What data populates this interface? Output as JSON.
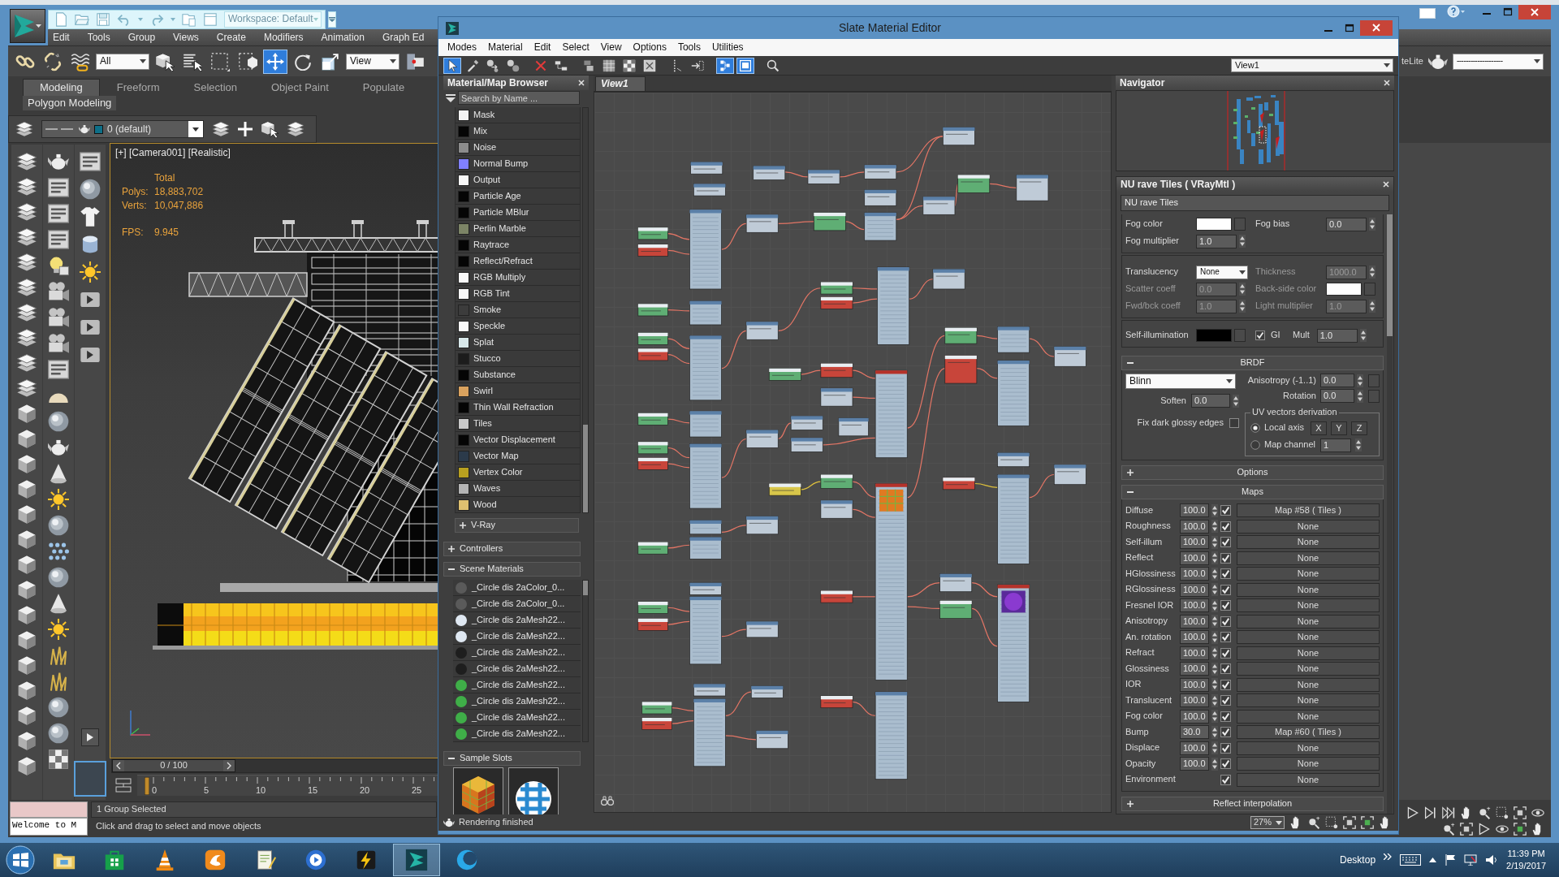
{
  "main_window": {
    "quick_access": {
      "workspace": "Workspace: Default"
    },
    "menu": [
      "Edit",
      "Tools",
      "Group",
      "Views",
      "Create",
      "Modifiers",
      "Animation",
      "Graph Ed"
    ],
    "toolbar": {
      "selection_filter": "All",
      "transform_tools": [
        {
          "selected": true
        },
        {
          "selected": false
        },
        {
          "selected": false
        }
      ],
      "reference_coordinate": "View",
      "right_label": "teLite",
      "named_selection": "--------------------"
    },
    "ribbon": {
      "tabs": [
        {
          "label": "Modeling",
          "selected": true
        },
        {
          "label": "Freeform",
          "selected": false
        },
        {
          "label": "Selection",
          "selected": false
        },
        {
          "label": "Object Paint",
          "selected": false
        },
        {
          "label": "Populate",
          "selected": false
        }
      ],
      "panel": "Polygon Modeling"
    },
    "layer_toolbar": {
      "layer": "0 (default)"
    },
    "viewport": {
      "label": "[+] [Camera001] [Realistic]",
      "stats_heading": "Total",
      "stats": [
        {
          "label": "Polys:",
          "value": "18,883,702"
        },
        {
          "label": "Verts:",
          "value": "10,047,886"
        }
      ],
      "fps": {
        "label": "FPS:",
        "value": "9.945"
      }
    },
    "time_slider": {
      "frame": "0 / 100",
      "level": 0,
      "ticks": [
        "0",
        "5",
        "10",
        "15",
        "20",
        "25"
      ]
    },
    "status_bar": {
      "listener": "Welcome to M",
      "selection": "1 Group Selected",
      "prompt": "Click and drag to select and move objects"
    }
  },
  "slate_editor": {
    "title": "Slate Material Editor",
    "menu": [
      "Modes",
      "Material",
      "Edit",
      "Select",
      "View",
      "Options",
      "Tools",
      "Utilities"
    ],
    "toolbar": {
      "tools": [
        {
          "on": true
        },
        {
          "on": false
        },
        {
          "on": false
        },
        {
          "on": false
        },
        {
          "on": false
        },
        {
          "on": false
        },
        {
          "on": false
        },
        {
          "on": false
        },
        {
          "on": false
        },
        {
          "on": false
        },
        {
          "on": false
        },
        {
          "on": false
        },
        {
          "on": true
        },
        {
          "on": true
        },
        {
          "on": false
        }
      ],
      "view": "View1"
    },
    "browser": {
      "title": "Material/Map Browser",
      "search": {
        "placeholder": "Search by Name ..."
      },
      "maps": [
        {
          "name": "Mask",
          "color": "#f4f4f4"
        },
        {
          "name": "Mix",
          "color": "#050505"
        },
        {
          "name": "Noise",
          "color": "#8c8c8c"
        },
        {
          "name": "Normal Bump",
          "color": "#8080ff"
        },
        {
          "name": "Output",
          "color": "#f8f8f8"
        },
        {
          "name": "Particle Age",
          "color": "#050505"
        },
        {
          "name": "Particle MBlur",
          "color": "#050505"
        },
        {
          "name": "Perlin Marble",
          "color": "#7c8466"
        },
        {
          "name": "Raytrace",
          "color": "#050505"
        },
        {
          "name": "Reflect/Refract",
          "color": "#050505"
        },
        {
          "name": "RGB Multiply",
          "color": "#f8f8f8"
        },
        {
          "name": "RGB Tint",
          "color": "#f8f8f8"
        },
        {
          "name": "Smoke",
          "color": "#3c3c3c"
        },
        {
          "name": "Speckle",
          "color": "#f8f8f8"
        },
        {
          "name": "Splat",
          "color": "#d8e8ea"
        },
        {
          "name": "Stucco",
          "color": "#1c1c1c"
        },
        {
          "name": "Substance",
          "color": "#050505"
        },
        {
          "name": "Swirl",
          "color": "#d9a25e"
        },
        {
          "name": "Thin Wall Refraction",
          "color": "#050505"
        },
        {
          "name": "Tiles",
          "color": "#c9c9c9"
        },
        {
          "name": "Vector Displacement",
          "color": "#050505"
        },
        {
          "name": "Vector Map",
          "color": "#2b3a4a"
        },
        {
          "name": "Vertex Color",
          "color": "#b8a020"
        },
        {
          "name": "Waves",
          "color": "#b4b4b4"
        },
        {
          "name": "Wood",
          "color": "#dfc070"
        }
      ],
      "sections": [
        {
          "label": "V-Ray",
          "kind": "subgroup",
          "expanded": false
        },
        {
          "label": "Controllers",
          "kind": "group",
          "expanded": false
        },
        {
          "label": "Scene Materials",
          "kind": "group",
          "expanded": true,
          "items": [
            {
              "name": "_Circle dis 2aColor_0...",
              "color": "#5a5a5a"
            },
            {
              "name": "_Circle dis 2aColor_0...",
              "color": "#5a5a5a"
            },
            {
              "name": "_Circle dis 2aMesh22...",
              "color": "#dfe8f2"
            },
            {
              "name": "_Circle dis 2aMesh22...",
              "color": "#dfe8f2"
            },
            {
              "name": "_Circle dis 2aMesh22...",
              "color": "#1e1e1e"
            },
            {
              "name": "_Circle dis 2aMesh22...",
              "color": "#1e1e1e"
            },
            {
              "name": "_Circle dis 2aMesh22...",
              "color": "#3fae48"
            },
            {
              "name": "_Circle dis 2aMesh22...",
              "color": "#3fae48"
            },
            {
              "name": "_Circle dis 2aMesh22...",
              "color": "#3fae48"
            },
            {
              "name": "_Circle dis 2aMesh22...",
              "color": "#3fae48"
            }
          ]
        },
        {
          "label": "Sample Slots",
          "kind": "group",
          "expanded": true,
          "slots": [
            {
              "kind": "cube"
            },
            {
              "kind": "sphere"
            }
          ]
        }
      ]
    },
    "view": {
      "tabs": [
        {
          "label": "View1",
          "selected": true
        }
      ],
      "zoom": "27%"
    },
    "navigator": {
      "title": "Navigator"
    },
    "material": {
      "title": "NU rave Tiles ( VRayMtl )",
      "name": "NU rave Tiles",
      "groups": [
        [
          [
            {
              "label": "Fog color",
              "kind": "swatch",
              "color": "#ffffff",
              "disabled": false
            },
            {
              "label": "Fog bias",
              "kind": "spinner",
              "value": "0.0",
              "disabled": false
            }
          ],
          [
            {
              "label": "Fog multiplier",
              "kind": "spinner",
              "value": "1.0",
              "disabled": false
            }
          ]
        ],
        [
          [
            {
              "label": "Translucency",
              "kind": "dropdown",
              "value": "None",
              "disabled": false
            },
            {
              "label": "Thickness",
              "kind": "spinner",
              "value": "1000.0",
              "disabled": true
            }
          ],
          [
            {
              "label": "Scatter coeff",
              "kind": "spinner",
              "value": "0.0",
              "disabled": true
            },
            {
              "label": "Back-side color",
              "kind": "swatch",
              "color": "#ffffff",
              "disabled": true
            }
          ],
          [
            {
              "label": "Fwd/bck coeff",
              "kind": "spinner",
              "value": "1.0",
              "disabled": true
            },
            {
              "label": "Light multiplier",
              "kind": "spinner",
              "value": "1.0",
              "disabled": true
            }
          ]
        ],
        [
          [
            {
              "label": "Self-illumination",
              "kind": "swatch",
              "color": "#000000",
              "disabled": false
            },
            {
              "label": "GI",
              "kind": "check",
              "checked": true,
              "disabled": false
            },
            {
              "label": "Mult",
              "kind": "spinner",
              "value": "1.0",
              "disabled": false
            }
          ]
        ]
      ],
      "rollouts": [
        {
          "label": "BRDF",
          "kind": "brdf",
          "expanded": true,
          "shader": "Blinn",
          "spinners": [
            {
              "label": "Anisotropy (-1..1)",
              "value": "0.0"
            },
            {
              "label": "Rotation",
              "value": "0.0"
            }
          ],
          "soften": {
            "label": "Soften",
            "value": "0.0"
          },
          "fix_dark_glossy": {
            "label": "Fix dark glossy edges",
            "checked": false
          },
          "uv_vectors": {
            "title": "UV vectors derivation",
            "options": [
              {
                "label": "Local axis",
                "selected": true
              },
              {
                "label": "Map channel",
                "selected": false
              }
            ],
            "axes": [
              "X",
              "Y",
              "Z"
            ],
            "channel": "1"
          }
        },
        {
          "label": "Options",
          "expanded": false
        },
        {
          "label": "Maps",
          "kind": "maps",
          "expanded": true,
          "rows": [
            {
              "label": "Diffuse",
              "amount": "100.0",
              "checked": true,
              "map": "Map #58 ( Tiles )"
            },
            {
              "label": "Roughness",
              "amount": "100.0",
              "checked": true,
              "map": "None"
            },
            {
              "label": "Self-illum",
              "amount": "100.0",
              "checked": true,
              "map": "None"
            },
            {
              "label": "Reflect",
              "amount": "100.0",
              "checked": true,
              "map": "None"
            },
            {
              "label": "HGlossiness",
              "amount": "100.0",
              "checked": true,
              "map": "None"
            },
            {
              "label": "RGlossiness",
              "amount": "100.0",
              "checked": true,
              "map": "None"
            },
            {
              "label": "Fresnel IOR",
              "amount": "100.0",
              "checked": true,
              "map": "None"
            },
            {
              "label": "Anisotropy",
              "amount": "100.0",
              "checked": true,
              "map": "None"
            },
            {
              "label": "An. rotation",
              "amount": "100.0",
              "checked": true,
              "map": "None"
            },
            {
              "label": "Refract",
              "amount": "100.0",
              "checked": true,
              "map": "None"
            },
            {
              "label": "Glossiness",
              "amount": "100.0",
              "checked": true,
              "map": "None"
            },
            {
              "label": "IOR",
              "amount": "100.0",
              "checked": true,
              "map": "None"
            },
            {
              "label": "Translucent",
              "amount": "100.0",
              "checked": true,
              "map": "None"
            },
            {
              "label": "Fog color",
              "amount": "100.0",
              "checked": true,
              "map": "None"
            },
            {
              "label": "Bump",
              "amount": "30.0",
              "checked": true,
              "map": "Map #60 ( Tiles )"
            },
            {
              "label": "Displace",
              "amount": "100.0",
              "checked": true,
              "map": "None"
            },
            {
              "label": "Opacity",
              "amount": "100.0",
              "checked": true,
              "map": "None"
            },
            {
              "label": "Environment",
              "checked": true,
              "map": "None"
            }
          ]
        },
        {
          "label": "Reflect interpolation",
          "expanded": false
        }
      ]
    },
    "status": "Rendering finished"
  },
  "taskbar": {
    "apps": [
      {
        "selected": false
      },
      {
        "selected": false
      },
      {
        "selected": false
      },
      {
        "selected": false
      },
      {
        "selected": false
      },
      {
        "selected": false
      },
      {
        "selected": false
      },
      {
        "selected": true
      },
      {
        "selected": false
      }
    ],
    "desktop": "Desktop",
    "time": "11:39 PM",
    "date": "2/19/2017"
  }
}
